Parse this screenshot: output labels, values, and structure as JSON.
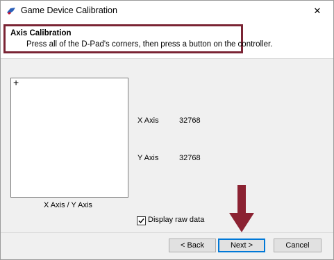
{
  "window": {
    "title": "Game Device Calibration",
    "close_glyph": "✕"
  },
  "header": {
    "title": "Axis Calibration",
    "subtitle": "Press all of the D-Pad's corners, then press a button on the controller."
  },
  "plot": {
    "label": "X Axis / Y Axis",
    "crosshair": "+"
  },
  "axes": [
    {
      "name": "X Axis",
      "value": "32768"
    },
    {
      "name": "Y Axis",
      "value": "32768"
    }
  ],
  "options": {
    "display_raw_label": "Display raw data",
    "display_raw_checked": true
  },
  "buttons": {
    "back": "< Back",
    "next": "Next >",
    "cancel": "Cancel"
  },
  "colors": {
    "highlight": "#7a2434",
    "arrow": "#8b2232",
    "default_button_border": "#0078d7"
  }
}
